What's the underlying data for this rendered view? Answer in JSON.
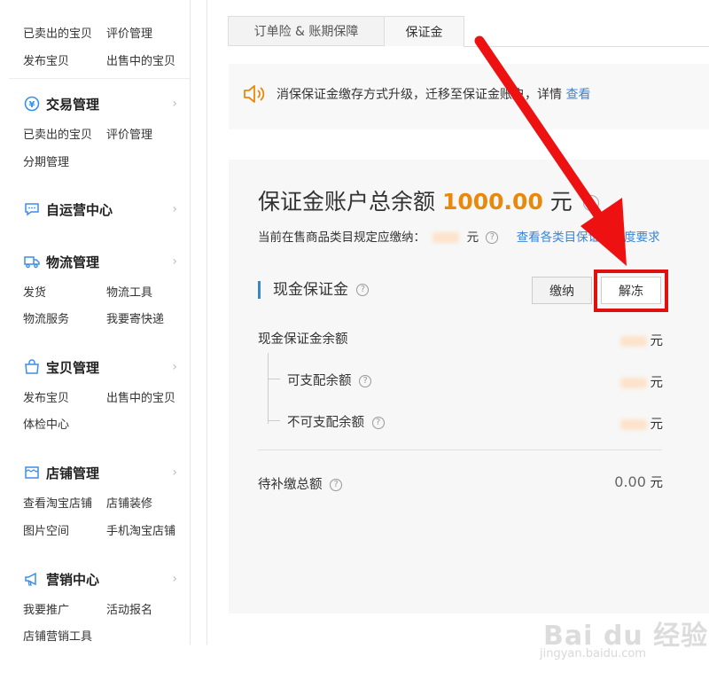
{
  "sidebar": {
    "top_rows": [
      [
        "已卖出的宝贝",
        "评价管理"
      ],
      [
        "发布宝贝",
        "出售中的宝贝"
      ]
    ],
    "sections": [
      {
        "title": "交易管理",
        "icon": "yen-circle-icon",
        "rows": [
          [
            "已卖出的宝贝",
            "评价管理"
          ],
          [
            "分期管理",
            ""
          ]
        ]
      },
      {
        "title": "自运营中心",
        "icon": "chat-bubble-icon",
        "rows": []
      },
      {
        "title": "物流管理",
        "icon": "truck-icon",
        "rows": [
          [
            "发货",
            "物流工具"
          ],
          [
            "物流服务",
            "我要寄快递"
          ]
        ]
      },
      {
        "title": "宝贝管理",
        "icon": "bag-icon",
        "rows": [
          [
            "发布宝贝",
            "出售中的宝贝"
          ],
          [
            "体检中心",
            ""
          ]
        ]
      },
      {
        "title": "店铺管理",
        "icon": "store-icon",
        "rows": [
          [
            "查看淘宝店铺",
            "店铺装修"
          ],
          [
            "图片空间",
            "手机淘宝店铺"
          ]
        ]
      },
      {
        "title": "营销中心",
        "icon": "megaphone-icon",
        "rows": [
          [
            "我要推广",
            "活动报名"
          ],
          [
            "店铺营销工具",
            ""
          ]
        ]
      }
    ]
  },
  "tabs": [
    {
      "label": "订单险 & 账期保障",
      "active": false
    },
    {
      "label": "保证金",
      "active": true
    }
  ],
  "notice": {
    "text": "消保保证金缴存方式升级，迁移至保证金账户，详情",
    "link": "查看"
  },
  "account": {
    "total_label": "保证金账户总余额",
    "total_amount": "1000.00",
    "total_unit": "元",
    "required_label": "当前在售商品类目规定应缴纳：",
    "required_unit": "元",
    "required_link": "查看各类目保证金额度要求",
    "section_title": "现金保证金",
    "pay_button": "缴纳",
    "unfreeze_button": "解冻",
    "cash_balance_label": "现金保证金余额",
    "available_label": "可支配余额",
    "unavailable_label": "不可支配余额",
    "pending_label": "待补缴总额",
    "pending_value": "0.00",
    "unit": "元"
  },
  "watermark": {
    "brand": "Bai du 经验",
    "url": "jingyan.baidu.com"
  },
  "colors": {
    "accent_blue": "#3a84d6",
    "amount_orange": "#e8890c",
    "highlight_red": "#e01010"
  }
}
